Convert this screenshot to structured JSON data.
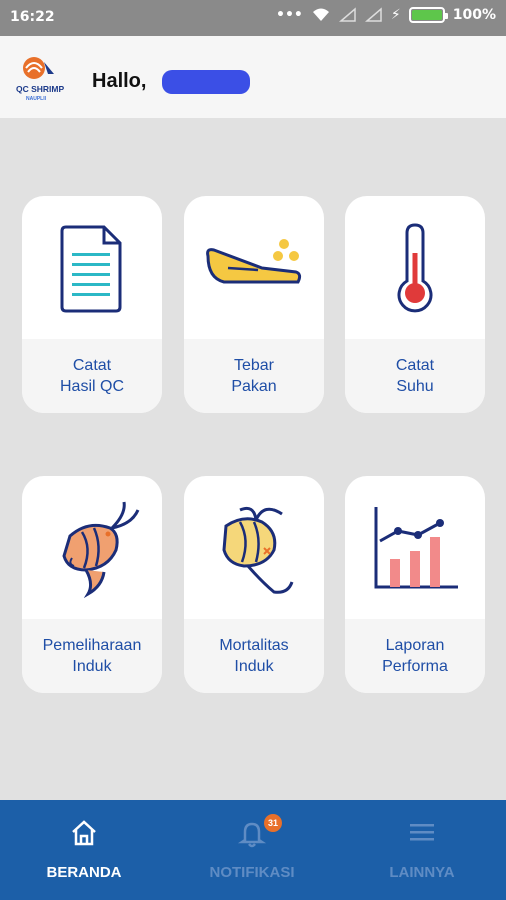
{
  "status": {
    "time": "16:22",
    "battery": "100%"
  },
  "header": {
    "greeting": "Hallo,",
    "logo_text": "QC SHRIMP",
    "logo_sub": "NAUPLII"
  },
  "menu": [
    {
      "label": "Catat\nHasil QC",
      "icon": "document-icon"
    },
    {
      "label": "Tebar\nPakan",
      "icon": "feed-scatter-icon"
    },
    {
      "label": "Catat\nSuhu",
      "icon": "thermometer-icon"
    },
    {
      "label": "Pemeliharaan\nInduk",
      "icon": "shrimp-icon"
    },
    {
      "label": "Mortalitas\nInduk",
      "icon": "dead-shrimp-icon"
    },
    {
      "label": "Laporan\nPerforma",
      "icon": "chart-icon"
    }
  ],
  "nav": {
    "home": "BERANDA",
    "notif": "NOTIFIKASI",
    "notif_count": "31",
    "more": "LAINNYA"
  },
  "colors": {
    "primary": "#1c5fa8",
    "accent": "#f5c842",
    "text": "#1f4ea6"
  }
}
